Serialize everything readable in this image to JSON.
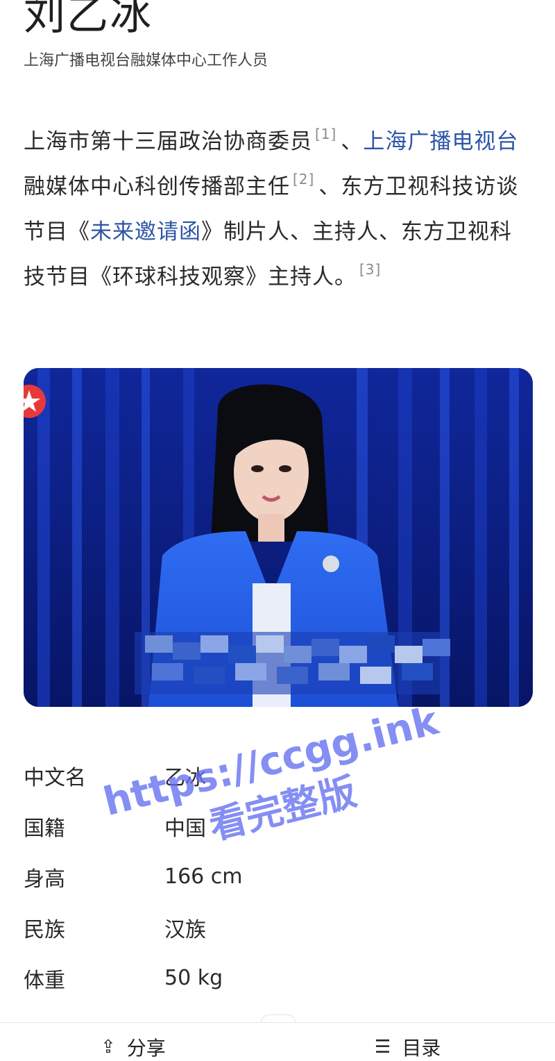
{
  "page": {
    "title": "刘乙冰",
    "subtitle": "上海广播电视台融媒体中心工作人员"
  },
  "summary": {
    "part1": "上海市第十三届政治协商委员",
    "ref1": "[1]",
    "sep1": "、",
    "link1": "上海广播电视台",
    "part2": "融媒体中心科创传播部主任",
    "ref2": "[2]",
    "part3": "、东方卫视科技访谈节目《",
    "link2": "未来邀请函",
    "part4": "》制片人、主持人、东方卫视科技节目《环球科技观察》主持人。",
    "ref3": "[3]"
  },
  "infobox": [
    {
      "key": "中文名",
      "value": "乙冰"
    },
    {
      "key": "国籍",
      "value": "中国"
    },
    {
      "key": "身高",
      "value": "166 cm"
    },
    {
      "key": "民族",
      "value": "汉族"
    },
    {
      "key": "体重",
      "value": "50 kg"
    }
  ],
  "watermark": {
    "line1": "https://ccgg.ink",
    "line2": "看完整版"
  },
  "bottom_bar": {
    "share_label": "分享",
    "share_icon": "share-icon",
    "toc_label": "目录",
    "toc_icon": "list-icon"
  },
  "colors": {
    "link": "#2d55a6",
    "watermark": "#626ef0",
    "stage_blue": "#0b1e7a"
  }
}
